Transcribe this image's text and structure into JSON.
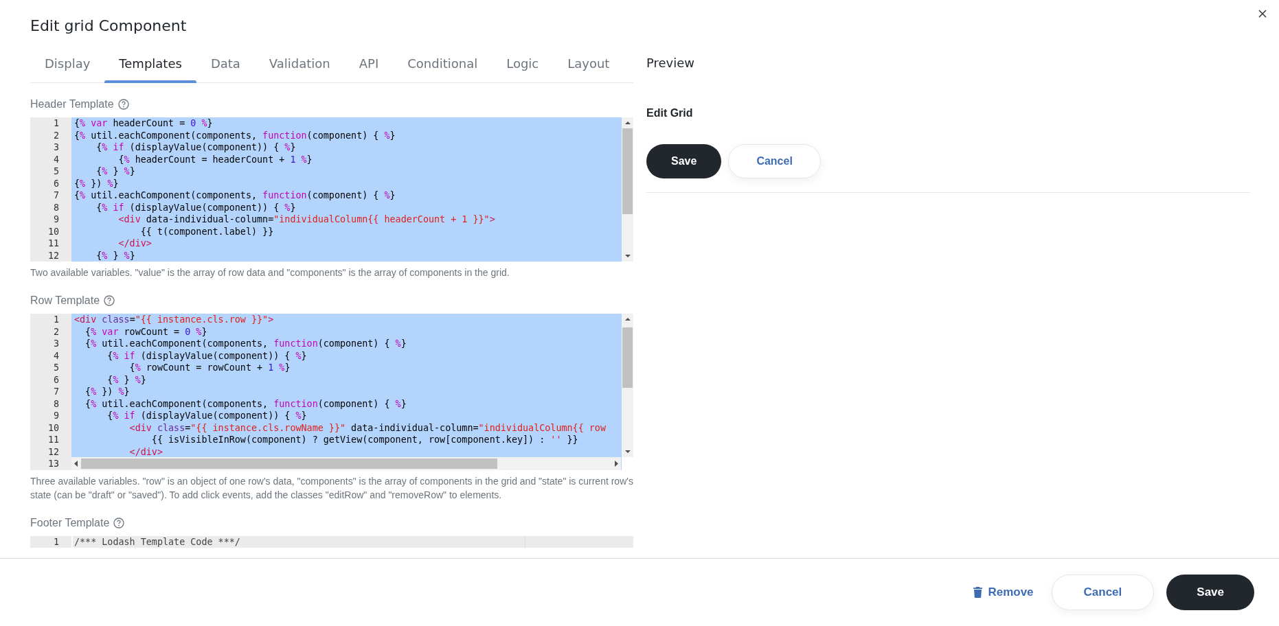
{
  "dialog": {
    "title": "Edit grid Component"
  },
  "tabs": [
    {
      "label": "Display",
      "selected": false
    },
    {
      "label": "Templates",
      "selected": true
    },
    {
      "label": "Data",
      "selected": false
    },
    {
      "label": "Validation",
      "selected": false
    },
    {
      "label": "API",
      "selected": false
    },
    {
      "label": "Conditional",
      "selected": false
    },
    {
      "label": "Logic",
      "selected": false
    },
    {
      "label": "Layout",
      "selected": false
    }
  ],
  "templates": [
    {
      "label": "Header Template",
      "text_selected": true,
      "vertical_scrollbar": true,
      "horizontal_scrollbar": false,
      "lines": [
        {
          "number": "1",
          "segments": [
            {
              "kind": "plain",
              "text": "{"
            },
            {
              "kind": "delim",
              "text": "%"
            },
            {
              "kind": "keyword",
              "text": " var"
            },
            {
              "kind": "plain",
              "text": " headerCount = "
            },
            {
              "kind": "number",
              "text": "0"
            },
            {
              "kind": "delim",
              "text": " %"
            },
            {
              "kind": "plain",
              "text": "}"
            }
          ]
        },
        {
          "number": "2",
          "segments": [
            {
              "kind": "plain",
              "text": "{"
            },
            {
              "kind": "delim",
              "text": "%"
            },
            {
              "kind": "plain",
              "text": " util.eachComponent(components, "
            },
            {
              "kind": "keyword",
              "text": "function"
            },
            {
              "kind": "plain",
              "text": "(component) { "
            },
            {
              "kind": "delim",
              "text": "%"
            },
            {
              "kind": "plain",
              "text": "}"
            }
          ]
        },
        {
          "number": "3",
          "segments": [
            {
              "kind": "plain",
              "text": "    {"
            },
            {
              "kind": "delim",
              "text": "%"
            },
            {
              "kind": "keyword",
              "text": " if"
            },
            {
              "kind": "plain",
              "text": " (displayValue(component)) { "
            },
            {
              "kind": "delim",
              "text": "%"
            },
            {
              "kind": "plain",
              "text": "}"
            }
          ]
        },
        {
          "number": "4",
          "segments": [
            {
              "kind": "plain",
              "text": "        {"
            },
            {
              "kind": "delim",
              "text": "%"
            },
            {
              "kind": "plain",
              "text": " headerCount = headerCount + "
            },
            {
              "kind": "number",
              "text": "1"
            },
            {
              "kind": "delim",
              "text": " %"
            },
            {
              "kind": "plain",
              "text": "}"
            }
          ]
        },
        {
          "number": "5",
          "segments": [
            {
              "kind": "plain",
              "text": "    {"
            },
            {
              "kind": "delim",
              "text": "%"
            },
            {
              "kind": "plain",
              "text": " } "
            },
            {
              "kind": "delim",
              "text": "%"
            },
            {
              "kind": "plain",
              "text": "}"
            }
          ]
        },
        {
          "number": "6",
          "segments": [
            {
              "kind": "plain",
              "text": "{"
            },
            {
              "kind": "delim",
              "text": "%"
            },
            {
              "kind": "plain",
              "text": " }) "
            },
            {
              "kind": "delim",
              "text": "%"
            },
            {
              "kind": "plain",
              "text": "}"
            }
          ]
        },
        {
          "number": "7",
          "segments": [
            {
              "kind": "plain",
              "text": "{"
            },
            {
              "kind": "delim",
              "text": "%"
            },
            {
              "kind": "plain",
              "text": " util.eachComponent(components, "
            },
            {
              "kind": "keyword",
              "text": "function"
            },
            {
              "kind": "plain",
              "text": "(component) { "
            },
            {
              "kind": "delim",
              "text": "%"
            },
            {
              "kind": "plain",
              "text": "}"
            }
          ]
        },
        {
          "number": "8",
          "segments": [
            {
              "kind": "plain",
              "text": "    {"
            },
            {
              "kind": "delim",
              "text": "%"
            },
            {
              "kind": "keyword",
              "text": " if"
            },
            {
              "kind": "plain",
              "text": " (displayValue(component)) { "
            },
            {
              "kind": "delim",
              "text": "%"
            },
            {
              "kind": "plain",
              "text": "}"
            }
          ]
        },
        {
          "number": "9",
          "segments": [
            {
              "kind": "tag",
              "text": "        <div"
            },
            {
              "kind": "plain",
              "text": " data-individual-column="
            },
            {
              "kind": "string",
              "text": "\"individualColumn{{ headerCount + 1 }}\""
            },
            {
              "kind": "tag",
              "text": ">"
            }
          ]
        },
        {
          "number": "10",
          "segments": [
            {
              "kind": "plain",
              "text": "            {{ t(component.label) }}"
            }
          ]
        },
        {
          "number": "11",
          "segments": [
            {
              "kind": "tag",
              "text": "        </div>"
            }
          ]
        },
        {
          "number": "12",
          "segments": [
            {
              "kind": "plain",
              "text": "    {"
            },
            {
              "kind": "delim",
              "text": "%"
            },
            {
              "kind": "plain",
              "text": " } "
            },
            {
              "kind": "delim",
              "text": "%"
            },
            {
              "kind": "plain",
              "text": "}"
            }
          ]
        }
      ],
      "help": "Two available variables. \"value\" is the array of row data and \"components\" is the array of components in the grid."
    },
    {
      "label": "Row Template",
      "text_selected": true,
      "vertical_scrollbar": true,
      "horizontal_scrollbar": true,
      "lines": [
        {
          "number": "1",
          "segments": [
            {
              "kind": "tag",
              "text": "<div"
            },
            {
              "kind": "attr",
              "text": " class"
            },
            {
              "kind": "plain",
              "text": "="
            },
            {
              "kind": "string",
              "text": "\"{{ instance.cls.row }}\""
            },
            {
              "kind": "tag",
              "text": ">"
            }
          ]
        },
        {
          "number": "2",
          "segments": [
            {
              "kind": "plain",
              "text": "  {"
            },
            {
              "kind": "delim",
              "text": "%"
            },
            {
              "kind": "keyword",
              "text": " var"
            },
            {
              "kind": "plain",
              "text": " rowCount = "
            },
            {
              "kind": "number",
              "text": "0"
            },
            {
              "kind": "delim",
              "text": " %"
            },
            {
              "kind": "plain",
              "text": "}"
            }
          ]
        },
        {
          "number": "3",
          "segments": [
            {
              "kind": "plain",
              "text": "  {"
            },
            {
              "kind": "delim",
              "text": "%"
            },
            {
              "kind": "plain",
              "text": " util.eachComponent(components, "
            },
            {
              "kind": "keyword",
              "text": "function"
            },
            {
              "kind": "plain",
              "text": "(component) { "
            },
            {
              "kind": "delim",
              "text": "%"
            },
            {
              "kind": "plain",
              "text": "}"
            }
          ]
        },
        {
          "number": "4",
          "segments": [
            {
              "kind": "plain",
              "text": "      {"
            },
            {
              "kind": "delim",
              "text": "%"
            },
            {
              "kind": "keyword",
              "text": " if"
            },
            {
              "kind": "plain",
              "text": " (displayValue(component)) { "
            },
            {
              "kind": "delim",
              "text": "%"
            },
            {
              "kind": "plain",
              "text": "}"
            }
          ]
        },
        {
          "number": "5",
          "segments": [
            {
              "kind": "plain",
              "text": "          {"
            },
            {
              "kind": "delim",
              "text": "%"
            },
            {
              "kind": "plain",
              "text": " rowCount = rowCount + "
            },
            {
              "kind": "number",
              "text": "1"
            },
            {
              "kind": "delim",
              "text": " %"
            },
            {
              "kind": "plain",
              "text": "}"
            }
          ]
        },
        {
          "number": "6",
          "segments": [
            {
              "kind": "plain",
              "text": "      {"
            },
            {
              "kind": "delim",
              "text": "%"
            },
            {
              "kind": "plain",
              "text": " } "
            },
            {
              "kind": "delim",
              "text": "%"
            },
            {
              "kind": "plain",
              "text": "}"
            }
          ]
        },
        {
          "number": "7",
          "segments": [
            {
              "kind": "plain",
              "text": "  {"
            },
            {
              "kind": "delim",
              "text": "%"
            },
            {
              "kind": "plain",
              "text": " }) "
            },
            {
              "kind": "delim",
              "text": "%"
            },
            {
              "kind": "plain",
              "text": "}"
            }
          ]
        },
        {
          "number": "8",
          "segments": [
            {
              "kind": "plain",
              "text": "  {"
            },
            {
              "kind": "delim",
              "text": "%"
            },
            {
              "kind": "plain",
              "text": " util.eachComponent(components, "
            },
            {
              "kind": "keyword",
              "text": "function"
            },
            {
              "kind": "plain",
              "text": "(component) { "
            },
            {
              "kind": "delim",
              "text": "%"
            },
            {
              "kind": "plain",
              "text": "}"
            }
          ]
        },
        {
          "number": "9",
          "segments": [
            {
              "kind": "plain",
              "text": "      {"
            },
            {
              "kind": "delim",
              "text": "%"
            },
            {
              "kind": "keyword",
              "text": " if"
            },
            {
              "kind": "plain",
              "text": " (displayValue(component)) { "
            },
            {
              "kind": "delim",
              "text": "%"
            },
            {
              "kind": "plain",
              "text": "}"
            }
          ]
        },
        {
          "number": "10",
          "segments": [
            {
              "kind": "tag",
              "text": "          <div"
            },
            {
              "kind": "attr",
              "text": " class"
            },
            {
              "kind": "plain",
              "text": "="
            },
            {
              "kind": "string",
              "text": "\"{{ instance.cls.rowName }}\""
            },
            {
              "kind": "plain",
              "text": " data-individual-column="
            },
            {
              "kind": "string",
              "text": "\"individualColumn{{ row"
            }
          ]
        },
        {
          "number": "11",
          "segments": [
            {
              "kind": "plain",
              "text": "              {{ isVisibleInRow(component) ? getView(component, row[component.key]) : "
            },
            {
              "kind": "string",
              "text": "''"
            },
            {
              "kind": "plain",
              "text": " }}"
            }
          ]
        },
        {
          "number": "12",
          "segments": [
            {
              "kind": "tag",
              "text": "          </div>"
            }
          ]
        },
        {
          "number": "13"
        }
      ],
      "help": "Three available variables. \"row\" is an object of one row's data, \"components\" is the array of components in the grid and \"state\" is current row's state (can be \"draft\" or \"saved\"). To add click events, add the classes \"editRow\" and \"removeRow\" to elements."
    },
    {
      "label": "Footer Template",
      "text_selected": false,
      "vertical_scrollbar": false,
      "horizontal_scrollbar": false,
      "lines": [
        {
          "number": "1",
          "segments": [
            {
              "kind": "comment",
              "text": "/*** Lodash Template Code ***/"
            }
          ]
        }
      ]
    }
  ],
  "preview": {
    "title": "Preview",
    "component_label": "Edit Grid",
    "buttons": [
      {
        "label": "Save",
        "kind": "primary"
      },
      {
        "label": "Cancel",
        "kind": "secondary"
      }
    ]
  },
  "footer": {
    "buttons": [
      {
        "label": "Remove",
        "kind": "link"
      },
      {
        "label": "Cancel",
        "kind": "secondary"
      },
      {
        "label": "Save",
        "kind": "primary"
      }
    ]
  }
}
